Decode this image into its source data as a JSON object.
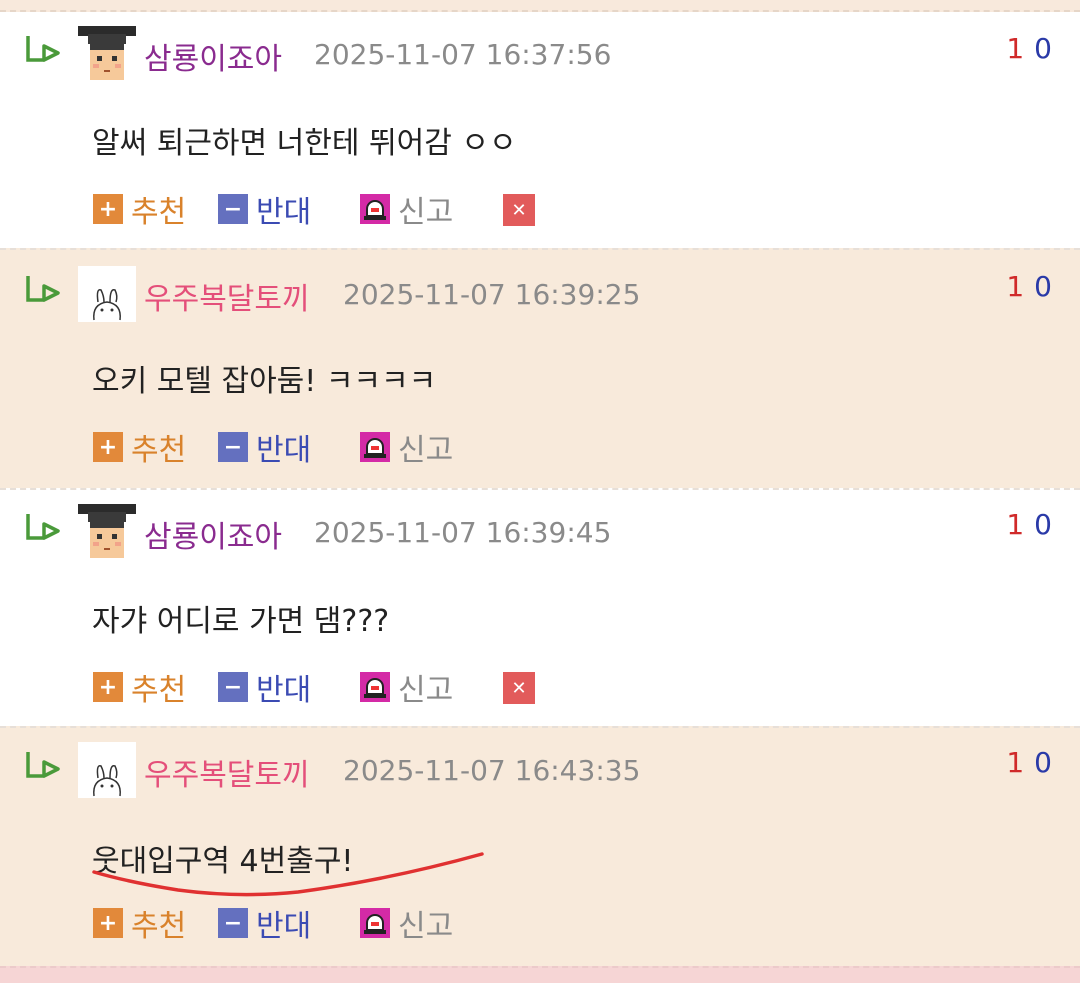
{
  "comments": [
    {
      "nickname": "삼룡이죠아",
      "timestamp": "2025-11-07 16:37:56",
      "text": "알써 퇴근하면 너한테 뛰어감 ㅇㅇ",
      "up": "1",
      "down": "0",
      "avatar": "graduate-avatar"
    },
    {
      "nickname": "우주복달토끼",
      "timestamp": "2025-11-07 16:39:25",
      "text": "오키 모텔 잡아둠! ㅋㅋㅋㅋ",
      "up": "1",
      "down": "0",
      "avatar": "bunny-avatar"
    },
    {
      "nickname": "삼룡이죠아",
      "timestamp": "2025-11-07 16:39:45",
      "text": "자갸 어디로 가면 댐???",
      "up": "1",
      "down": "0",
      "avatar": "graduate-avatar"
    },
    {
      "nickname": "우주복달토끼",
      "timestamp": "2025-11-07 16:43:35",
      "text": "웃대입구역 4번출구!",
      "up": "1",
      "down": "0",
      "avatar": "bunny-avatar"
    }
  ],
  "actions": {
    "recommend": "추천",
    "oppose": "반대",
    "report": "신고",
    "plus_symbol": "+",
    "minus_symbol": "−",
    "delete_symbol": "✕"
  },
  "colors": {
    "alt_background": "#f8eadb",
    "purple_nick": "#8a2b8f",
    "pink_nick": "#e44f7a",
    "up_vote": "#d02a2a",
    "down_vote": "#2a3aa8",
    "annotation_stroke": "#e03131"
  }
}
